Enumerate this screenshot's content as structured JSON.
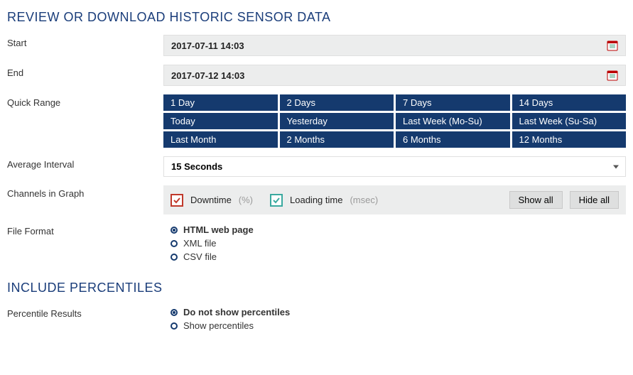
{
  "sections": {
    "historic": {
      "title": "REVIEW OR DOWNLOAD HISTORIC SENSOR DATA",
      "start_label": "Start",
      "start_value": "2017-07-11 14:03",
      "end_label": "End",
      "end_value": "2017-07-12 14:03",
      "quick_range_label": "Quick Range",
      "quick_ranges": [
        "1 Day",
        "2 Days",
        "7 Days",
        "14 Days",
        "Today",
        "Yesterday",
        "Last Week (Mo-Su)",
        "Last Week (Su-Sa)",
        "Last Month",
        "2 Months",
        "6 Months",
        "12 Months"
      ],
      "avg_interval_label": "Average Interval",
      "avg_interval_value": "15 Seconds",
      "channels_label": "Channels in Graph",
      "channels": [
        {
          "name": "Downtime",
          "unit": "(%)",
          "color": "red",
          "checked": true
        },
        {
          "name": "Loading time",
          "unit": "(msec)",
          "color": "teal",
          "checked": true
        }
      ],
      "show_all": "Show all",
      "hide_all": "Hide all",
      "file_format_label": "File Format",
      "file_formats": [
        {
          "label": "HTML web page",
          "selected": true
        },
        {
          "label": "XML file",
          "selected": false
        },
        {
          "label": "CSV file",
          "selected": false
        }
      ]
    },
    "percentiles": {
      "title": "INCLUDE PERCENTILES",
      "results_label": "Percentile Results",
      "options": [
        {
          "label": "Do not show percentiles",
          "selected": true
        },
        {
          "label": "Show percentiles",
          "selected": false
        }
      ]
    }
  }
}
